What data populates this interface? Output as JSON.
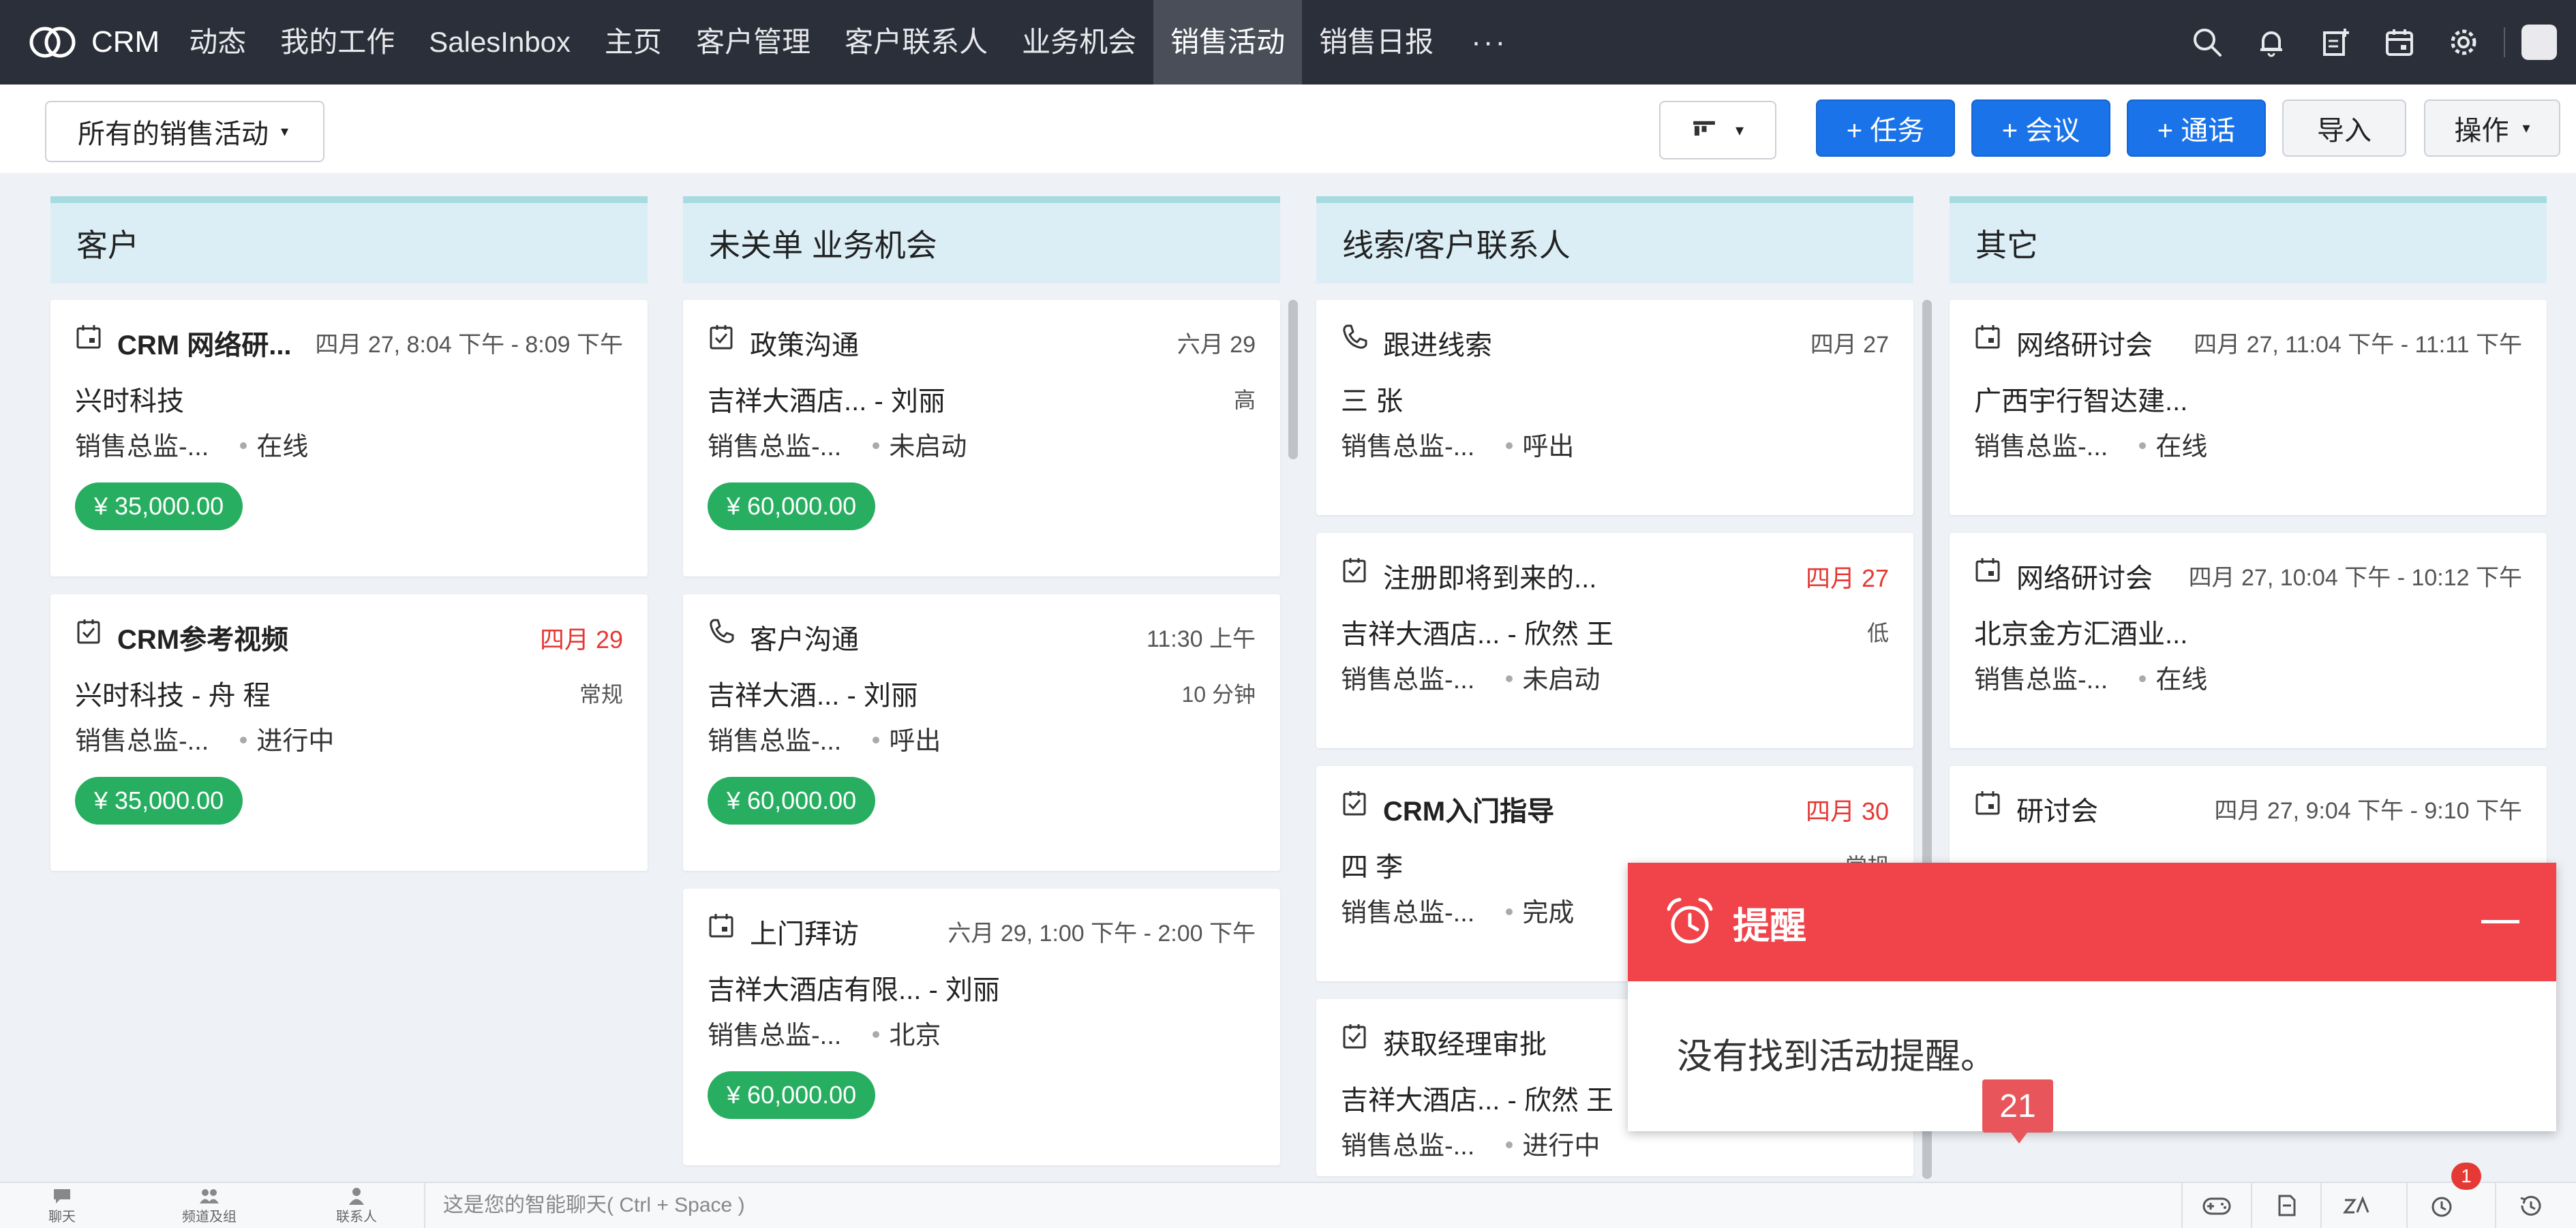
{
  "nav": {
    "brand": "CRM",
    "items": [
      "动态",
      "我的工作",
      "SalesInbox",
      "主页",
      "客户管理",
      "客户联系人",
      "业务机会",
      "销售活动",
      "销售日报"
    ],
    "active_index": 7,
    "more": "···"
  },
  "toolbar": {
    "filter_label": "所有的销售活动",
    "task_label": "+ 任务",
    "meeting_label": "+ 会议",
    "call_label": "+ 通话",
    "import_label": "导入",
    "action_label": "操作"
  },
  "columns": [
    {
      "title": "客户",
      "cards": [
        {
          "icon": "calendar-icon",
          "title": "CRM 网络研...",
          "date": "四月 27, 8:04 下午 - 8:09 下午",
          "line2": "兴时科技",
          "side": "",
          "owner": "销售总监-...",
          "status": "在线",
          "amount": "¥ 35,000.00"
        },
        {
          "icon": "task-icon",
          "title": "CRM参考视频",
          "date": "四月 29",
          "line2": "兴时科技 - 舟 程",
          "side": "常规",
          "owner": "销售总监-...",
          "status": "进行中",
          "amount": "¥ 35,000.00"
        }
      ]
    },
    {
      "title": "未关单 业务机会",
      "cards": [
        {
          "icon": "task-icon",
          "title": "政策沟通",
          "date": "六月 29",
          "line2": "吉祥大酒店...   - 刘丽",
          "side": "高",
          "owner": "销售总监-...",
          "status": "未启动",
          "amount": "¥ 60,000.00"
        },
        {
          "icon": "phone-icon",
          "title": "客户沟通",
          "date": "11:30 上午",
          "line2": "吉祥大酒...   - 刘丽",
          "side": "10 分钟",
          "owner": "销售总监-...",
          "status": "呼出",
          "amount": "¥ 60,000.00"
        },
        {
          "icon": "calendar-icon",
          "title": "上门拜访",
          "date": "六月 29, 1:00 下午 - 2:00 下午",
          "line2": "吉祥大酒店有限...   - 刘丽",
          "side": "",
          "owner": "销售总监-...",
          "status": "北京",
          "amount": "¥ 60,000.00"
        }
      ]
    },
    {
      "title": "线索/客户联系人",
      "cards": [
        {
          "icon": "phone-icon",
          "title": "跟进线索",
          "date": "四月 27",
          "line2": "三 张",
          "side": "",
          "owner": "销售总监-...",
          "status": "呼出"
        },
        {
          "icon": "task-icon",
          "title": "注册即将到来的...",
          "date": "四月 27",
          "line2": "吉祥大酒店...   - 欣然 王",
          "side": "低",
          "owner": "销售总监-...",
          "status": "未启动"
        },
        {
          "icon": "task-icon",
          "title": "CRM入门指导",
          "date": "四月 30",
          "line2": "四 李",
          "side": "常规",
          "owner": "销售总监-...",
          "status": "完成"
        },
        {
          "icon": "task-icon",
          "title": "获取经理审批",
          "date": "",
          "line2": "吉祥大酒店...   - 欣然 王",
          "side": "",
          "owner": "销售总监-...",
          "status": "进行中"
        }
      ]
    },
    {
      "title": "其它",
      "cards": [
        {
          "icon": "calendar-icon",
          "title": "网络研讨会",
          "date": "四月 27, 11:04 下午 - 11:11 下午",
          "line2": "广西宇行智达建...",
          "side": "",
          "owner": "销售总监-...",
          "status": "在线"
        },
        {
          "icon": "calendar-icon",
          "title": "网络研讨会",
          "date": "四月 27, 10:04 下午 - 10:12 下午",
          "line2": "北京金方汇酒业...",
          "side": "",
          "owner": "销售总监-...",
          "status": "在线"
        },
        {
          "icon": "calendar-icon",
          "title": "研讨会",
          "date": "四月 27, 9:04 下午 - 9:10 下午",
          "line2": "",
          "side": "",
          "owner": "",
          "status": ""
        }
      ]
    }
  ],
  "reminder": {
    "title": "提醒",
    "message": "没有找到活动提醒。",
    "count": "21"
  },
  "bottombar": {
    "chat": "聊天",
    "channels": "频道及组",
    "contacts": "联系人",
    "chat_placeholder": "这是您的智能聊天( Ctrl + Space )",
    "notification_count": "1"
  },
  "colors": {
    "nav_bg": "#2b2f3a",
    "accent_blue": "#1a73e8",
    "amount_green": "#27ae60",
    "reminder_red": "#f0434a",
    "due_red": "#e53935",
    "column_header": "#dbeef6"
  }
}
